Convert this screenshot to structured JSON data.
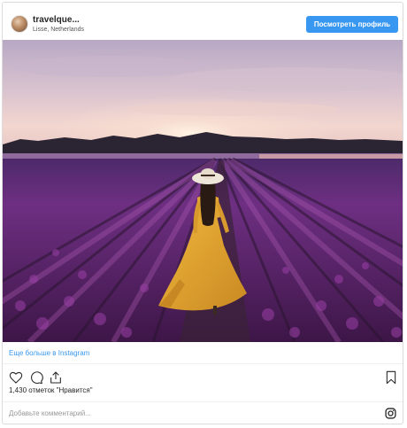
{
  "post": {
    "username": "travelque...",
    "location": "Lisse, Netherlands",
    "view_profile_label": "Посмотреть профиль"
  },
  "photo": {
    "subject": "woman-in-tulip-field",
    "colors": {
      "tulips": "#7a2f86",
      "dress": "#e1a530",
      "sky_glow": "#f7dccf"
    }
  },
  "more_link": "Еще больше в Instagram",
  "actions": {
    "like_icon": "heart-icon",
    "comment_icon": "comment-icon",
    "share_icon": "share-icon",
    "save_icon": "bookmark-icon"
  },
  "likes_text": "1,430 отметок \"Нравится\"",
  "comment": {
    "placeholder": "Добавьте комментарий...",
    "brand_icon": "instagram-icon"
  },
  "colors": {
    "accent": "#3897f0",
    "border": "#dbdbdb"
  }
}
